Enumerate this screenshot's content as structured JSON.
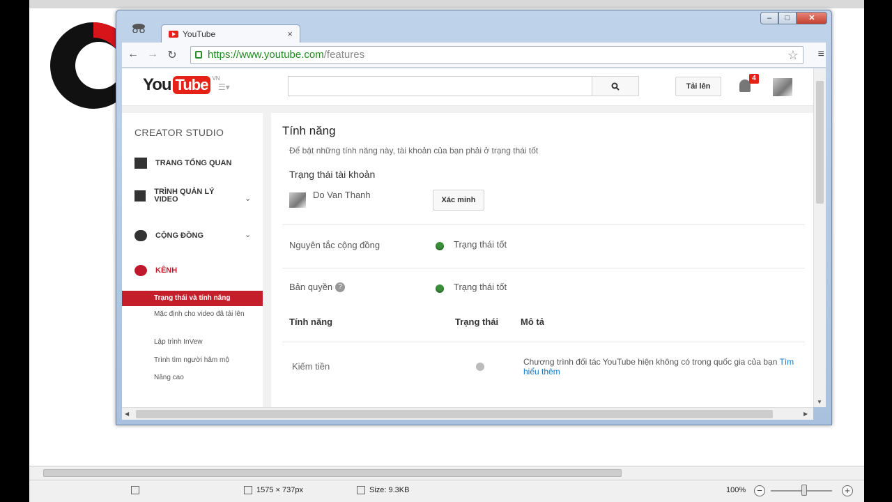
{
  "viewer": {
    "dimensions": "1575 × 737px",
    "size": "Size: 9.3KB",
    "zoom": "100%",
    "zoom_minus": "−",
    "zoom_plus": "+"
  },
  "browser": {
    "tab_title": "YouTube",
    "tab_close": "×",
    "url_scheme_host": "https://www.youtube.com",
    "url_path": "/features",
    "win_min": "–",
    "win_max": "□",
    "win_close": "✕"
  },
  "youtube": {
    "logo_you": "You",
    "logo_tube": "Tube",
    "country": "VN",
    "upload_label": "Tải lên",
    "notification_count": "4"
  },
  "sidebar": {
    "title": "CREATOR STUDIO",
    "sections": [
      {
        "label": "TRANG TỔNG QUAN"
      },
      {
        "label": "TRÌNH QUẢN LÝ VIDEO"
      },
      {
        "label": "CỘNG ĐỒNG"
      },
      {
        "label": "KÊNH"
      }
    ],
    "channel_items": [
      "Trạng thái và tính năng",
      "Mặc định cho video đã tải lên",
      "Lập trình InVew",
      "Trình tìm người hâm mộ",
      "Nâng cao"
    ]
  },
  "main": {
    "title": "Tính năng",
    "description": "Để bật những tính năng này, tài khoản của bạn phải ở trạng thái tốt",
    "account_heading": "Trạng thái tài khoản",
    "account_name": "Do Van Thanh",
    "verify_label": "Xác minh",
    "rows": [
      {
        "label": "Nguyên tắc cộng đồng",
        "status": "Trạng thái tốt"
      },
      {
        "label": "Bản quyền",
        "status": "Trạng thái tốt"
      }
    ],
    "table_headers": {
      "feature": "Tính năng",
      "status": "Trạng thái",
      "description": "Mô tả"
    },
    "features": [
      {
        "name": "Kiếm tiền",
        "description": "Chương trình đối tác YouTube hiện không có trong quốc gia của bạn",
        "link": "Tìm hiểu thêm"
      }
    ]
  }
}
